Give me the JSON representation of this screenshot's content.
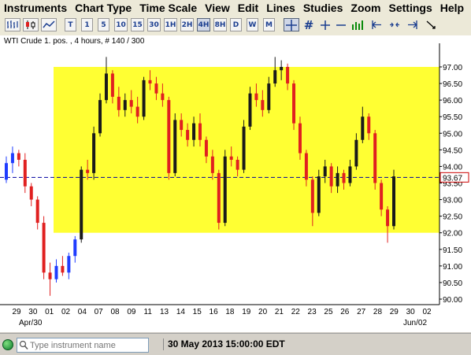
{
  "menu": [
    "Instruments",
    "Chart Type",
    "Time Scale",
    "View",
    "Edit",
    "Lines",
    "Studies",
    "Zoom",
    "Settings",
    "Help"
  ],
  "toolbar": {
    "timeframes": [
      "T",
      "1",
      "5",
      "10",
      "15",
      "30",
      "1H",
      "2H",
      "4H",
      "8H",
      "D",
      "W",
      "M"
    ],
    "active_timeframe": "4H"
  },
  "chart_header": "WTI Crude 1. pos. , 4 hours, # 140 / 300",
  "price_axis": [
    "97.00",
    "96.50",
    "96.00",
    "95.50",
    "95.00",
    "94.50",
    "94.00",
    "93.50",
    "93.00",
    "92.50",
    "92.00",
    "91.50",
    "91.00",
    "90.50",
    "90.00"
  ],
  "current_price": "93.67",
  "date_axis": [
    "29",
    "30",
    "01",
    "02",
    "04",
    "07",
    "08",
    "09",
    "11",
    "13",
    "14",
    "15",
    "16",
    "18",
    "19",
    "20",
    "21",
    "22",
    "23",
    "25",
    "26",
    "27",
    "28",
    "29",
    "30",
    "02"
  ],
  "month_labels": [
    "Apr/30",
    "Jun/02"
  ],
  "status": {
    "instrument_placeholder": "Type instrument name",
    "datetime": "30 May 2013 15:00:00 EDT"
  },
  "colors": {
    "up": "#1a1a1a",
    "down": "#e02020",
    "early_up": "#1f3cff",
    "band": "#ffff33",
    "current_line": "#0000a0"
  },
  "chart_data": {
    "type": "candlestick",
    "title": "WTI Crude 1. pos. , 4 hours, # 140 / 300",
    "ylim": [
      90.0,
      97.0
    ],
    "highlight_band": [
      92.0,
      97.0
    ],
    "current_price": 93.67,
    "values": [
      [
        93.6,
        94.3,
        93.5,
        94.1
      ],
      [
        94.1,
        94.6,
        93.8,
        94.4
      ],
      [
        94.4,
        94.5,
        94.0,
        94.2
      ],
      [
        94.2,
        94.4,
        93.2,
        93.4
      ],
      [
        93.4,
        93.5,
        92.8,
        93.0
      ],
      [
        93.0,
        93.1,
        92.1,
        92.3
      ],
      [
        92.3,
        92.5,
        90.6,
        90.8
      ],
      [
        90.8,
        91.1,
        90.1,
        90.6
      ],
      [
        90.6,
        91.2,
        90.5,
        91.0
      ],
      [
        91.0,
        91.3,
        90.7,
        90.8
      ],
      [
        90.8,
        91.4,
        90.6,
        91.3
      ],
      [
        91.3,
        91.9,
        91.1,
        91.8
      ],
      [
        91.8,
        94.0,
        91.7,
        93.9
      ],
      [
        93.9,
        94.2,
        93.6,
        93.8
      ],
      [
        93.8,
        95.2,
        93.6,
        95.0
      ],
      [
        95.0,
        96.2,
        94.9,
        96.0
      ],
      [
        96.0,
        97.3,
        95.9,
        96.8
      ],
      [
        96.8,
        96.9,
        95.9,
        96.1
      ],
      [
        96.1,
        96.4,
        95.5,
        95.7
      ],
      [
        95.7,
        96.2,
        95.5,
        96.0
      ],
      [
        96.0,
        96.3,
        95.6,
        95.8
      ],
      [
        95.8,
        96.1,
        95.3,
        95.5
      ],
      [
        95.5,
        96.7,
        95.4,
        96.6
      ],
      [
        96.6,
        96.9,
        96.3,
        96.5
      ],
      [
        96.5,
        96.7,
        96.0,
        96.2
      ],
      [
        96.2,
        96.5,
        95.8,
        96.0
      ],
      [
        96.0,
        96.1,
        93.6,
        93.8
      ],
      [
        93.8,
        95.6,
        93.7,
        95.4
      ],
      [
        95.4,
        95.6,
        94.9,
        95.1
      ],
      [
        95.1,
        95.3,
        94.6,
        94.8
      ],
      [
        94.8,
        95.5,
        94.6,
        95.3
      ],
      [
        95.3,
        95.6,
        94.6,
        94.8
      ],
      [
        94.8,
        94.9,
        94.1,
        94.3
      ],
      [
        94.3,
        94.5,
        93.6,
        93.8
      ],
      [
        93.8,
        93.9,
        92.1,
        92.3
      ],
      [
        92.3,
        94.5,
        92.2,
        94.3
      ],
      [
        94.3,
        94.6,
        94.0,
        94.2
      ],
      [
        94.2,
        94.3,
        93.7,
        93.9
      ],
      [
        93.9,
        95.4,
        93.8,
        95.2
      ],
      [
        95.2,
        96.4,
        95.1,
        96.2
      ],
      [
        96.2,
        96.5,
        95.8,
        96.0
      ],
      [
        96.0,
        96.3,
        95.5,
        95.7
      ],
      [
        95.7,
        96.7,
        95.6,
        96.5
      ],
      [
        96.5,
        97.3,
        96.4,
        96.9
      ],
      [
        96.9,
        97.2,
        96.6,
        97.0
      ],
      [
        97.0,
        97.1,
        96.3,
        96.5
      ],
      [
        96.5,
        96.6,
        95.1,
        95.3
      ],
      [
        95.3,
        95.5,
        94.2,
        94.4
      ],
      [
        94.4,
        94.5,
        93.4,
        93.6
      ],
      [
        93.6,
        93.7,
        92.2,
        92.6
      ],
      [
        92.6,
        93.9,
        92.5,
        93.7
      ],
      [
        93.7,
        94.2,
        93.5,
        94.0
      ],
      [
        94.0,
        94.1,
        93.2,
        93.4
      ],
      [
        93.4,
        94.0,
        93.2,
        93.8
      ],
      [
        93.8,
        93.9,
        93.3,
        93.5
      ],
      [
        93.5,
        94.2,
        93.4,
        94.0
      ],
      [
        94.0,
        95.0,
        93.9,
        94.8
      ],
      [
        94.8,
        95.8,
        94.7,
        95.5
      ],
      [
        95.5,
        95.6,
        94.8,
        95.0
      ],
      [
        95.0,
        95.1,
        93.3,
        93.5
      ],
      [
        93.5,
        93.6,
        92.5,
        92.7
      ],
      [
        92.7,
        92.8,
        91.7,
        92.2
      ],
      [
        92.2,
        93.9,
        92.1,
        93.7
      ]
    ]
  }
}
